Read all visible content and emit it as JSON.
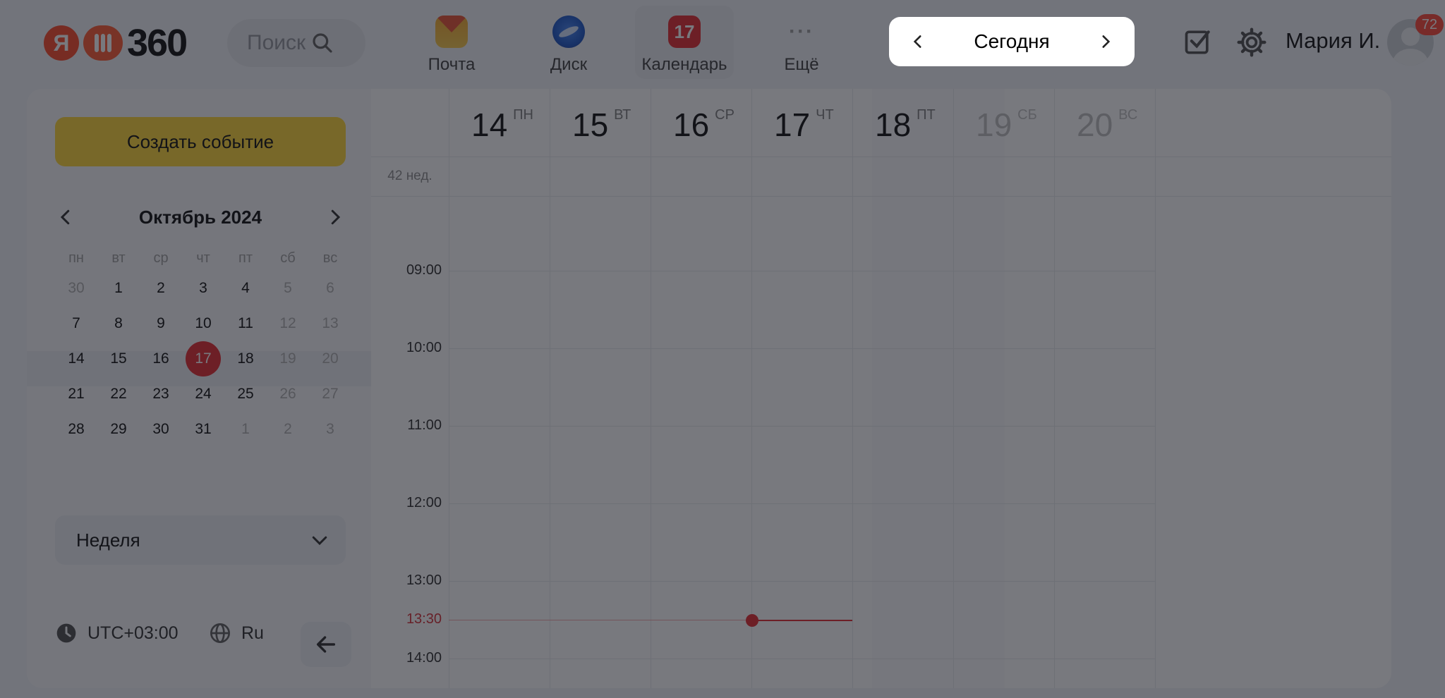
{
  "header": {
    "logo_text": "360",
    "logo_letter": "Я",
    "search_label": "Поиск",
    "apps": [
      {
        "label": "Почта",
        "icon": "mail-icon"
      },
      {
        "label": "Диск",
        "icon": "disk-icon"
      },
      {
        "label": "Календарь",
        "icon": "calendar-icon",
        "icon_text": "17"
      },
      {
        "label": "Ещё",
        "icon": "more-icon",
        "icon_text": "···"
      }
    ],
    "date_nav": {
      "today_label": "Сегодня"
    },
    "user_name": "Мария И.",
    "notifications_count": "72"
  },
  "sidebar": {
    "create_button": "Создать событие",
    "mini_calendar": {
      "month_label": "Октябрь 2024",
      "weekdays": [
        "пн",
        "вт",
        "ср",
        "чт",
        "пт",
        "сб",
        "вс"
      ],
      "weeks": [
        [
          "30",
          "1",
          "2",
          "3",
          "4",
          "5",
          "6"
        ],
        [
          "7",
          "8",
          "9",
          "10",
          "11",
          "12",
          "13"
        ],
        [
          "14",
          "15",
          "16",
          "17",
          "18",
          "19",
          "20"
        ],
        [
          "21",
          "22",
          "23",
          "24",
          "25",
          "26",
          "27"
        ],
        [
          "28",
          "29",
          "30",
          "31",
          "1",
          "2",
          "3"
        ]
      ],
      "today": "17"
    },
    "view_select": "Неделя",
    "timezone": "UTC+03:00",
    "language": "Ru"
  },
  "week_view": {
    "week_number": "42 нед.",
    "days": [
      {
        "num": "14",
        "wd": "ПН"
      },
      {
        "num": "15",
        "wd": "ВТ"
      },
      {
        "num": "16",
        "wd": "СР"
      },
      {
        "num": "17",
        "wd": "ЧТ"
      },
      {
        "num": "18",
        "wd": "ПТ"
      },
      {
        "num": "19",
        "wd": "СБ"
      },
      {
        "num": "20",
        "wd": "ВС"
      }
    ],
    "times": [
      "09:00",
      "10:00",
      "11:00",
      "12:00",
      "13:00",
      "14:00"
    ],
    "current_time": "13:30"
  },
  "colors": {
    "accent_yellow": "#fed42b",
    "today_red": "#e31e24",
    "overlay": "rgba(30,32,40,0.6)"
  }
}
